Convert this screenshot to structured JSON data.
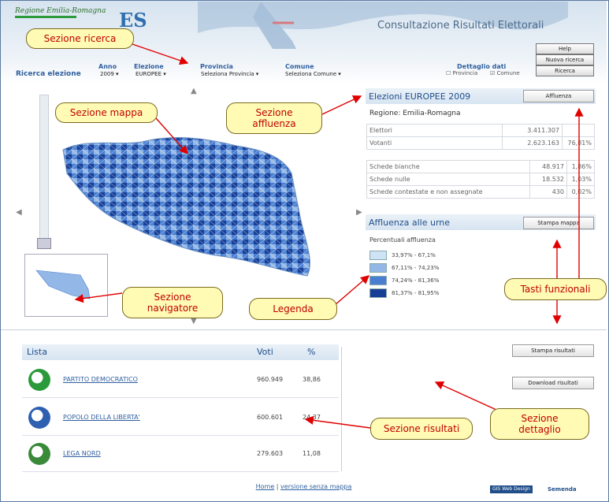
{
  "header": {
    "logo_rer": "Regione Emilia-Romagna",
    "logo_es": "ES",
    "title": "Consultazione Risultati Elettorali",
    "buttons": [
      "Help",
      "Nuova ricerca",
      "Ricerca"
    ]
  },
  "search": {
    "label": "Ricerca elezione",
    "field_labels": [
      "Anno",
      "Elezione",
      "Provincia",
      "Comune",
      "Dettaglio dati"
    ],
    "anno": "2009",
    "elezione": "EUROPEE",
    "provincia": "Seleziona Provincia",
    "comune": "Seleziona Comune",
    "check_provincia": "Provincia",
    "check_comune": "Comune"
  },
  "affluenza": {
    "title": "Elezioni EUROPEE 2009",
    "button": "Affluenza",
    "region": "Regione: Emilia-Romagna",
    "rows": [
      {
        "label": "Elettori",
        "value": "3.411.307",
        "pct": ""
      },
      {
        "label": "Votanti",
        "value": "2.623.163",
        "pct": "76,81%"
      }
    ],
    "schede": [
      {
        "label": "Schede bianche",
        "value": "48.917",
        "pct": "1,86%"
      },
      {
        "label": "Schede nulle",
        "value": "18.532",
        "pct": "1,03%"
      },
      {
        "label": "Schede contestate e non assegnate",
        "value": "430",
        "pct": "0,02%"
      }
    ]
  },
  "legend": {
    "title": "Affluenza alle urne",
    "button": "Stampa mappa",
    "subtitle": "Percentuali affluenza",
    "items": [
      {
        "label": "33,97% - 67,1%",
        "color": "#cfe3f7"
      },
      {
        "label": "67,11% - 74,23%",
        "color": "#93b7e6"
      },
      {
        "label": "74,24% - 81,36%",
        "color": "#4a7ed0"
      },
      {
        "label": "81,37% - 81,95%",
        "color": "#173f96"
      }
    ]
  },
  "results": {
    "headers": [
      "Lista",
      "Voti",
      "%"
    ],
    "rows": [
      {
        "name": "PARTITO DEMOCRATICO",
        "votes": "960.949",
        "pct": "38,86",
        "logo_color": "#2a9a3a"
      },
      {
        "name": "POPOLO DELLA LIBERTA'",
        "votes": "600.601",
        "pct": "24,37",
        "logo_color": "#2f5fb0"
      },
      {
        "name": "LEGA NORD",
        "votes": "279.603",
        "pct": "11,08",
        "logo_color": "#3a8a3a"
      }
    ],
    "btn_stampa": "Stampa risultati",
    "btn_download": "Download risultati"
  },
  "footer": {
    "home": "Home",
    "sep": "|",
    "link": "versione senza mappa",
    "brand1": "GIS Web Design",
    "brand2": "Semenda"
  },
  "callouts": {
    "ricerca": "Sezione ricerca",
    "mappa": "Sezione mappa",
    "affluenza": "Sezione affluenza",
    "navigatore": "Sezione navigatore",
    "legenda": "Legenda",
    "tasti": "Tasti funzionali",
    "risultati": "Sezione risultati",
    "dettaglio": "Sezione dettaglio"
  },
  "colors": {
    "accent": "#1f4e8a",
    "callout_text": "#c00000",
    "callout_bg": "#fffbb4",
    "arrow": "#e00000"
  }
}
